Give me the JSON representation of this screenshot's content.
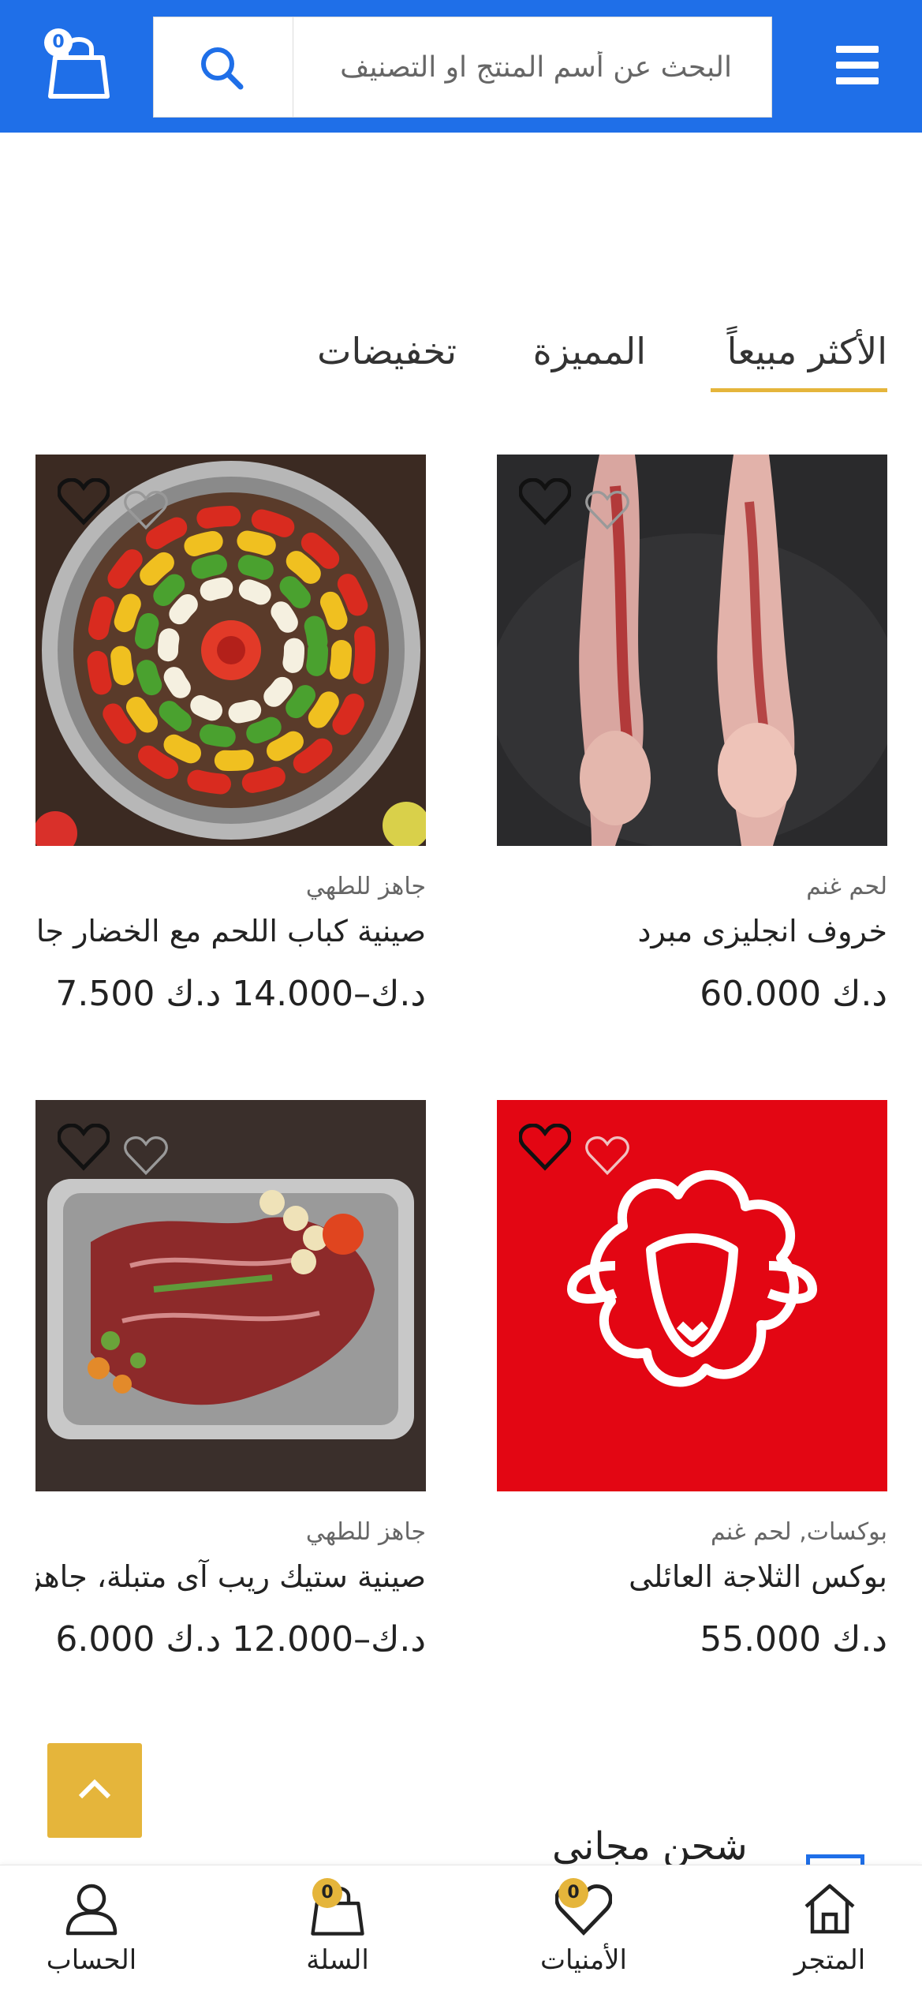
{
  "header": {
    "search_placeholder": "البحث عن أسم المنتج او التصنيف",
    "cart_count": "0",
    "icons": [
      "menu-icon",
      "search-icon",
      "shopping-bag-icon"
    ]
  },
  "tabs": [
    {
      "label": "الأكثر مبيعاً",
      "active": true
    },
    {
      "label": "المميزة",
      "active": false
    },
    {
      "label": "تخفيضات",
      "active": false
    }
  ],
  "products": [
    {
      "category": "لحم غنم",
      "name": "خروف انجليزى مبرد",
      "price": "60.000 د.ك",
      "image": "whole-lamb-carcass"
    },
    {
      "category": "جاهز للطهي",
      "name": "صينية كباب اللحم مع الخضار جاهزة",
      "price": "7.500 د.ك–14.000 د.ك",
      "image": "kebab-vegetable-tray"
    },
    {
      "category": "بوكسات, لحم غنم",
      "name": "بوكس الثلاجة العائلى",
      "price": "55.000 د.ك",
      "image": "sheep-logo-red"
    },
    {
      "category": "جاهز للطهي",
      "name": "صينية ستيك ريب آى متبلة، جاهزة",
      "price": "6.000 د.ك–12.000 د.ك",
      "image": "ribeye-steak-tray"
    }
  ],
  "shipping": {
    "title": "شحن مجاني"
  },
  "bottom_nav": [
    {
      "label": "المتجر",
      "icon": "home-icon"
    },
    {
      "label": "الأمنيات",
      "icon": "heart-icon",
      "badge": "0"
    },
    {
      "label": "السلة",
      "icon": "shopping-bag-icon",
      "badge": "0"
    },
    {
      "label": "الحساب",
      "icon": "user-icon"
    }
  ],
  "colors": {
    "primary": "#1f6fe8",
    "accent": "#e5b53b",
    "red": "#e30613"
  }
}
